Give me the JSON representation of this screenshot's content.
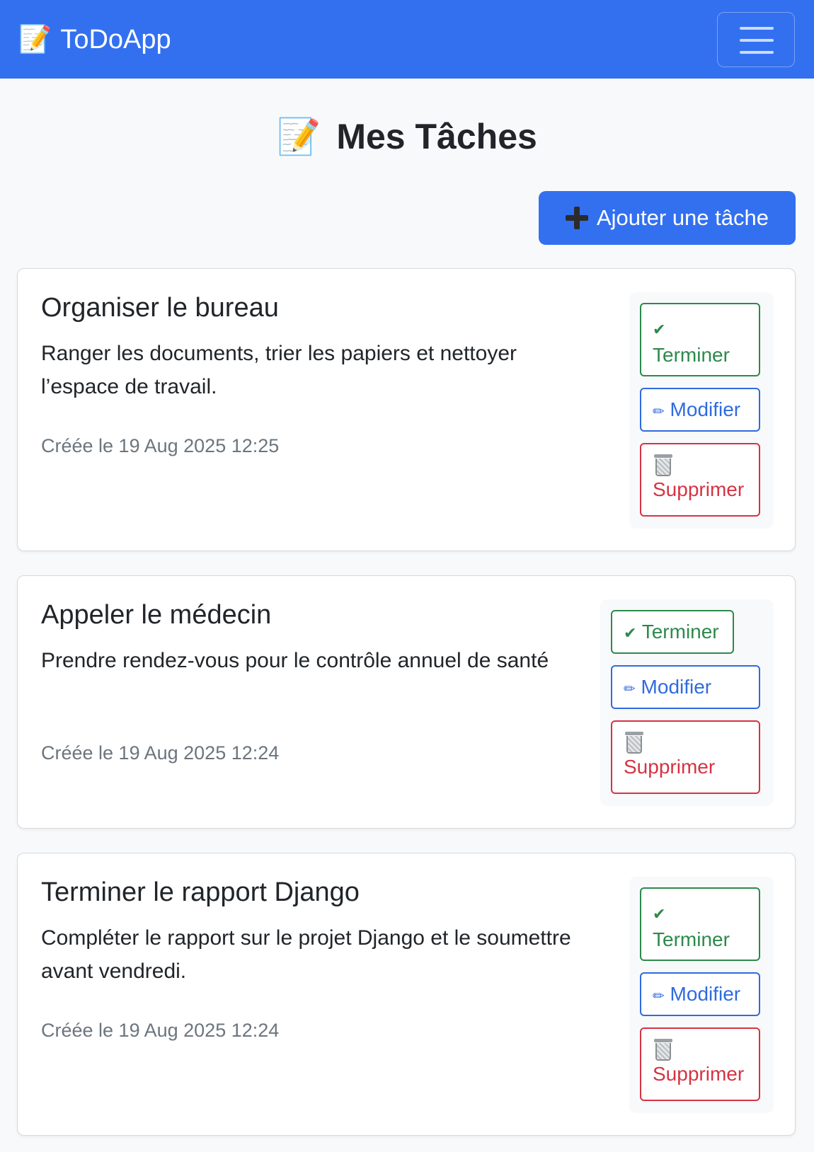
{
  "navbar": {
    "brand_icon": "📝",
    "brand": "ToDoApp",
    "toggler_icon": "hamburger-menu-icon",
    "background": "#3370f0"
  },
  "page": {
    "title_icon": "📝",
    "title": "Mes Tâches",
    "add_button_label": "Ajouter une tâche",
    "add_button_icon": "plus-icon"
  },
  "buttons": {
    "complete": "Terminer",
    "complete_icon": "✔",
    "edit": "Modifier",
    "edit_icon": "✏",
    "delete": "Supprimer",
    "delete_icon": "trash-icon"
  },
  "tasks": [
    {
      "title": "Organiser le bureau",
      "description": "Ranger les documents, trier les papiers et nettoyer l’espace de travail.",
      "created": "Créée le 19 Aug 2025 12:25"
    },
    {
      "title": "Appeler le médecin",
      "description": "Prendre rendez-vous pour le contrôle annuel de santé",
      "created": "Créée le 19 Aug 2025 12:24"
    },
    {
      "title": "Terminer le rapport Django",
      "description": "Compléter le rapport sur le projet Django et le soumettre avant vendredi.",
      "created": "Créée le 19 Aug 2025 12:24"
    }
  ],
  "colors": {
    "primary": "#3370f0",
    "success": "#2c8a4b",
    "info": "#2f6be0",
    "danger": "#d63343",
    "muted": "#6c757d"
  }
}
